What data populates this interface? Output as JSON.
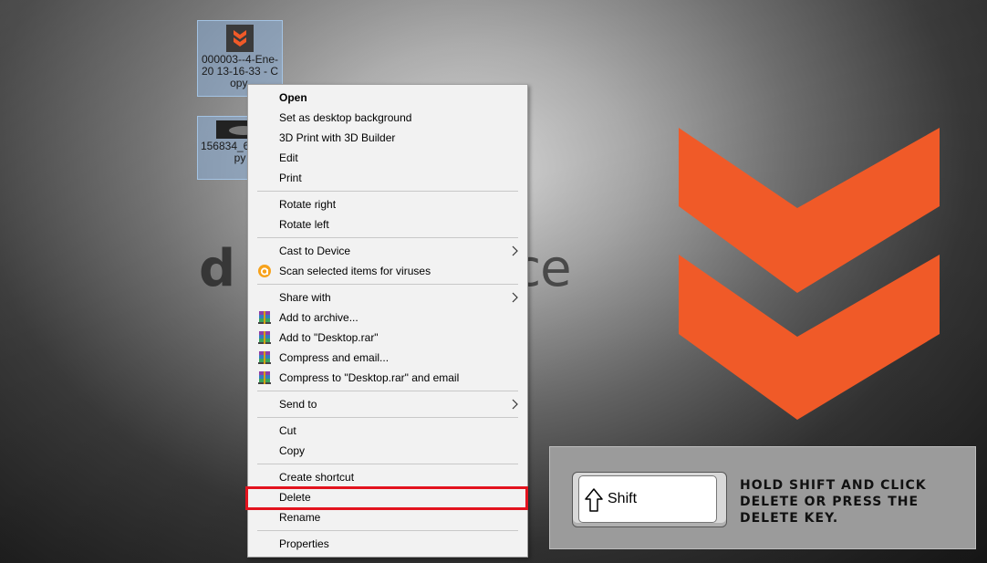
{
  "wallpaper": {
    "text_left": "d",
    "text_right": "urce",
    "logo_color": "#f05a28"
  },
  "desktop_icons": [
    {
      "label": "000003--4-Ene-20 13-16-33 - Copy.",
      "icon": "orange-chevron-thumbnail-icon"
    },
    {
      "label": "156834_62 - Copy",
      "icon": "dark-image-thumbnail-icon"
    }
  ],
  "context_menu": {
    "items": [
      {
        "label": "Open",
        "bold": true
      },
      {
        "label": "Set as desktop background"
      },
      {
        "label": "3D Print with 3D Builder"
      },
      {
        "label": "Edit"
      },
      {
        "label": "Print"
      },
      {
        "label": "Rotate right"
      },
      {
        "label": "Rotate left"
      },
      {
        "label": "Cast to Device",
        "submenu": true
      },
      {
        "label": "Scan selected items for viruses",
        "icon": "avast-icon"
      },
      {
        "label": "Share with",
        "submenu": true
      },
      {
        "label": "Add to archive...",
        "icon": "winrar-icon"
      },
      {
        "label": "Add to \"Desktop.rar\"",
        "icon": "winrar-icon"
      },
      {
        "label": "Compress and email...",
        "icon": "winrar-icon"
      },
      {
        "label": "Compress to \"Desktop.rar\" and email",
        "icon": "winrar-icon"
      },
      {
        "label": "Send to",
        "submenu": true
      },
      {
        "label": "Cut"
      },
      {
        "label": "Copy"
      },
      {
        "label": "Create shortcut"
      },
      {
        "label": "Delete",
        "highlighted": true
      },
      {
        "label": "Rename"
      },
      {
        "label": "Properties"
      }
    ],
    "highlight_color": "#e3131e"
  },
  "instruction": {
    "key_label": "Shift",
    "text": "Hold Shift and click Delete or press the Delete key."
  }
}
